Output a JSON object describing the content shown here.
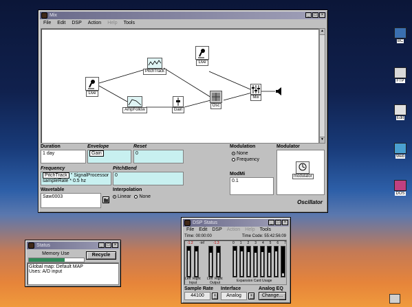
{
  "main_window": {
    "title": "Mix",
    "menu": [
      "File",
      "Edit",
      "DSP",
      "Action",
      "Help",
      "Tools"
    ],
    "menu_disabled": [
      false,
      false,
      false,
      false,
      true,
      false
    ],
    "nodes": {
      "live_left": "Live",
      "pitchtrack": "PitchTrack",
      "live_top": "Live",
      "ampfollow": "AmpFollow",
      "gain": "Gain",
      "osc": "Osc",
      "mix": "Mix"
    },
    "panel": {
      "duration_label": "Duration",
      "duration_value": "1 day",
      "envelope_label": "Envelope",
      "envelope_value": "Gain",
      "reset_label": "Reset",
      "reset_value": "0",
      "frequency_label": "Frequency",
      "frequency_tag": "PitchTrack",
      "frequency_line1": "\" SignalProcessor",
      "frequency_line2": "sampleRate * 0.5 hz",
      "pitchbend_label": "PitchBend",
      "pitchbend_value": "0",
      "wavetable_label": "Wavetable",
      "wavetable_value": "Saw0003",
      "interpolation_label": "Interpolation",
      "interp_linear": "Linear",
      "interp_none": "None",
      "modulation_label": "Modulation",
      "mod_none": "None",
      "mod_frequency": "Frequency",
      "modulator_label": "Modulator",
      "modulator_name": "modulator",
      "modmix_label": "ModMi",
      "modmix_value": "0.1",
      "class_name": "Oscillator"
    }
  },
  "status_window": {
    "title": "Status",
    "memory_label": "Memory Use",
    "memory_fraction": 0.65,
    "recycle_label": "Recycle",
    "line1": "Global map: Default MAP",
    "line2": "Uses: A/D input"
  },
  "dsp_window": {
    "title": "DSP Status",
    "menu": [
      "File",
      "Edit",
      "DSP",
      "Action",
      "Help",
      "Tools"
    ],
    "menu_disabled": [
      false,
      false,
      false,
      true,
      true,
      false
    ],
    "time_label": "Time: 00:00:00",
    "timecode_label": "Time Code: 55:42:56:09",
    "input_left_label": "Left",
    "input_right_label": "Right",
    "input_label": "Input",
    "input_left_value": "-1.2",
    "input_right_value": "-1.3",
    "output_left_label": "Left",
    "output_right_label": "Right",
    "output_label": "Output",
    "output_value": "-inf",
    "expansion_numbers": [
      "0",
      "1",
      "2",
      "3",
      "4",
      "5",
      "6",
      "7"
    ],
    "expansion_label": "Expansion Card Usage",
    "input_levels": [
      0.85,
      0.82
    ],
    "output_levels": [
      0.78,
      0.78
    ],
    "expansion_levels": [
      0.85,
      0.82,
      0.8,
      0.78,
      0.8,
      0.78,
      0.82,
      0.1
    ],
    "sample_rate_label": "Sample Rate",
    "sample_rate_value": "44100",
    "interface_label": "Interface",
    "interface_value": "Analog",
    "analog_eq_label": "Analog EQ",
    "change_label": "Change..."
  },
  "desktop_icons": [
    {
      "label": "BC",
      "icon": "computer-icon"
    },
    {
      "label": "FTP",
      "icon": "ftp-icon"
    },
    {
      "label": "Edit",
      "icon": "edit-icon"
    },
    {
      "label": "Web",
      "icon": "web-icon"
    },
    {
      "label": "DOS",
      "icon": "dos-icon"
    }
  ]
}
